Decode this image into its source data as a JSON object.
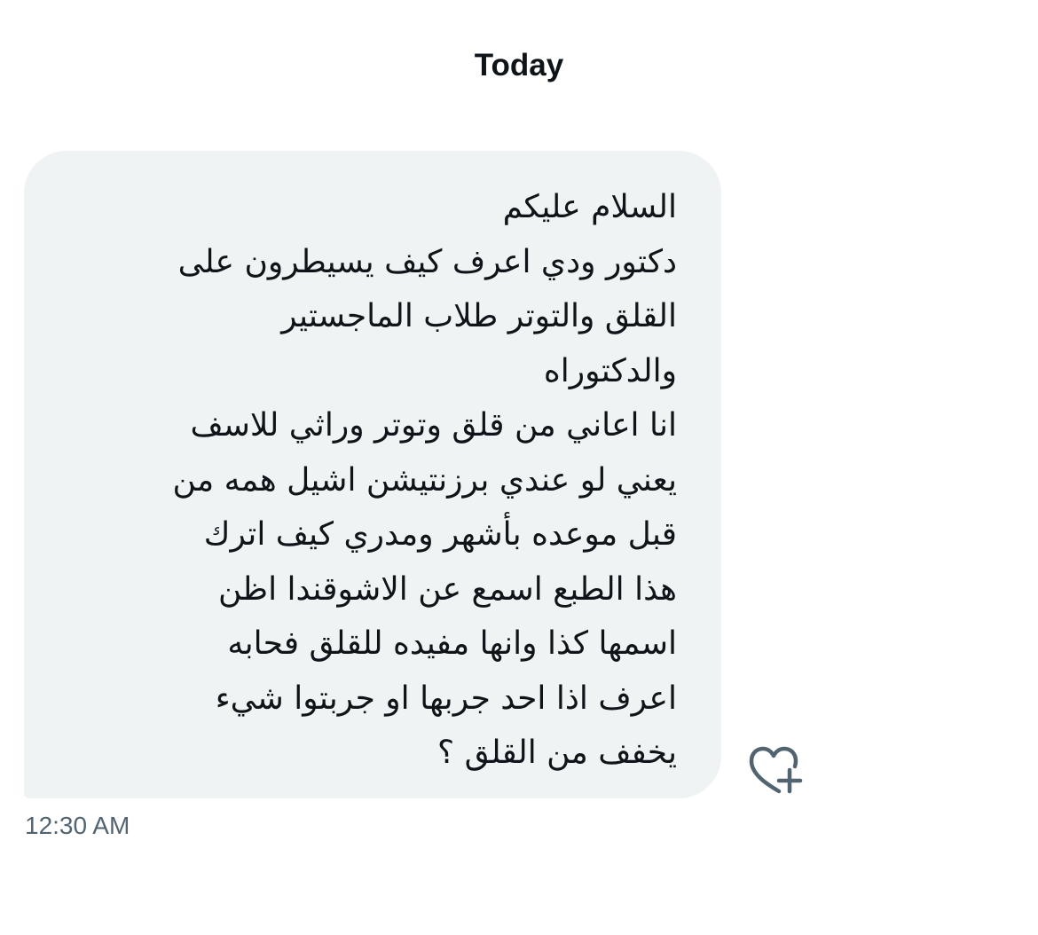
{
  "conversation": {
    "date_label": "Today",
    "messages": [
      {
        "lines": [
          "السلام عليكم",
          "دكتور ودي اعرف كيف يسيطرون على",
          "القلق والتوتر طلاب الماجستير",
          "والدكتوراه",
          "انا اعاني من قلق وتوتر وراثي للاسف",
          "يعني لو عندي برزنتيشن اشيل همه من",
          "قبل موعده بأشهر ومدري كيف اترك",
          "هذا الطبع اسمع عن الاشوقندا اظن",
          "اسمها كذا وانها مفيده للقلق فحابه",
          "اعرف اذا احد جربها او جربتوا شيء",
          "يخفف من القلق ؟"
        ],
        "timestamp": "12:30 AM",
        "reaction_icon": "heart-plus-icon"
      }
    ]
  },
  "colors": {
    "bubble_background": "#eff3f4",
    "text_primary": "#0f1419",
    "text_secondary": "#536471"
  }
}
